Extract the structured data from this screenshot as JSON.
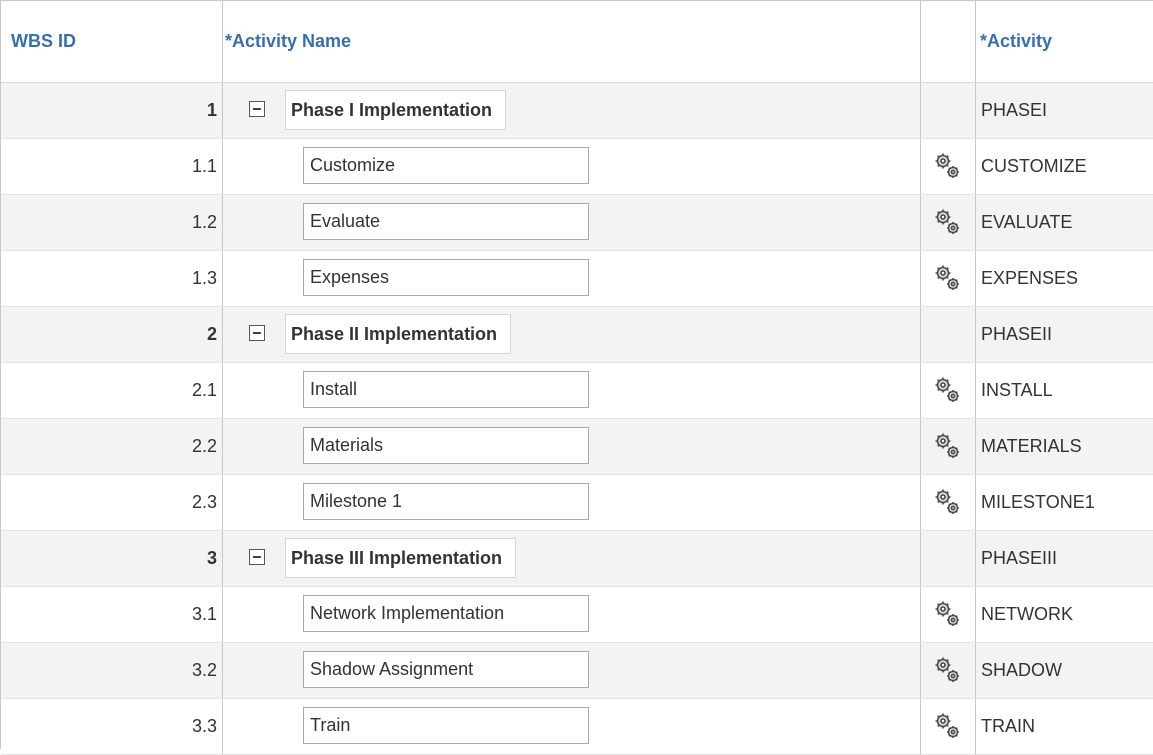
{
  "table": {
    "headers": {
      "wbs_id": "WBS ID",
      "activity_name": "*Activity Name",
      "activity": "*Activity"
    },
    "rows": [
      {
        "wbs": "1",
        "name": "Phase I Implementation",
        "activity": "PHASEI",
        "level": "phase",
        "icon": "none"
      },
      {
        "wbs": "1.1",
        "name": "Customize",
        "activity": "CUSTOMIZE",
        "level": "task",
        "icon": "gears-icon"
      },
      {
        "wbs": "1.2",
        "name": "Evaluate",
        "activity": "EVALUATE",
        "level": "task",
        "icon": "gears-icon"
      },
      {
        "wbs": "1.3",
        "name": "Expenses",
        "activity": "EXPENSES",
        "level": "task",
        "icon": "gears-icon"
      },
      {
        "wbs": "2",
        "name": "Phase II Implementation",
        "activity": "PHASEII",
        "level": "phase",
        "icon": "none"
      },
      {
        "wbs": "2.1",
        "name": "Install",
        "activity": "INSTALL",
        "level": "task",
        "icon": "gears-icon"
      },
      {
        "wbs": "2.2",
        "name": "Materials",
        "activity": "MATERIALS",
        "level": "task",
        "icon": "gears-icon"
      },
      {
        "wbs": "2.3",
        "name": "Milestone 1",
        "activity": "MILESTONE1",
        "level": "task",
        "icon": "gears-icon"
      },
      {
        "wbs": "3",
        "name": "Phase III Implementation",
        "activity": "PHASEIII",
        "level": "phase",
        "icon": "none"
      },
      {
        "wbs": "3.1",
        "name": "Network Implementation",
        "activity": "NETWORK",
        "level": "task",
        "icon": "gears-icon"
      },
      {
        "wbs": "3.2",
        "name": "Shadow Assignment",
        "activity": "SHADOW",
        "level": "task",
        "icon": "gears-icon"
      },
      {
        "wbs": "3.3",
        "name": "Train",
        "activity": "TRAIN",
        "level": "task",
        "icon": "gears-icon"
      }
    ]
  },
  "colors": {
    "header_text": "#3a6ea5",
    "zebra_row": "#f3f3f3",
    "grid_line": "#c8c8c8"
  },
  "icons": {
    "collapse": "minus-box-icon",
    "activity_link": "gears-icon"
  }
}
